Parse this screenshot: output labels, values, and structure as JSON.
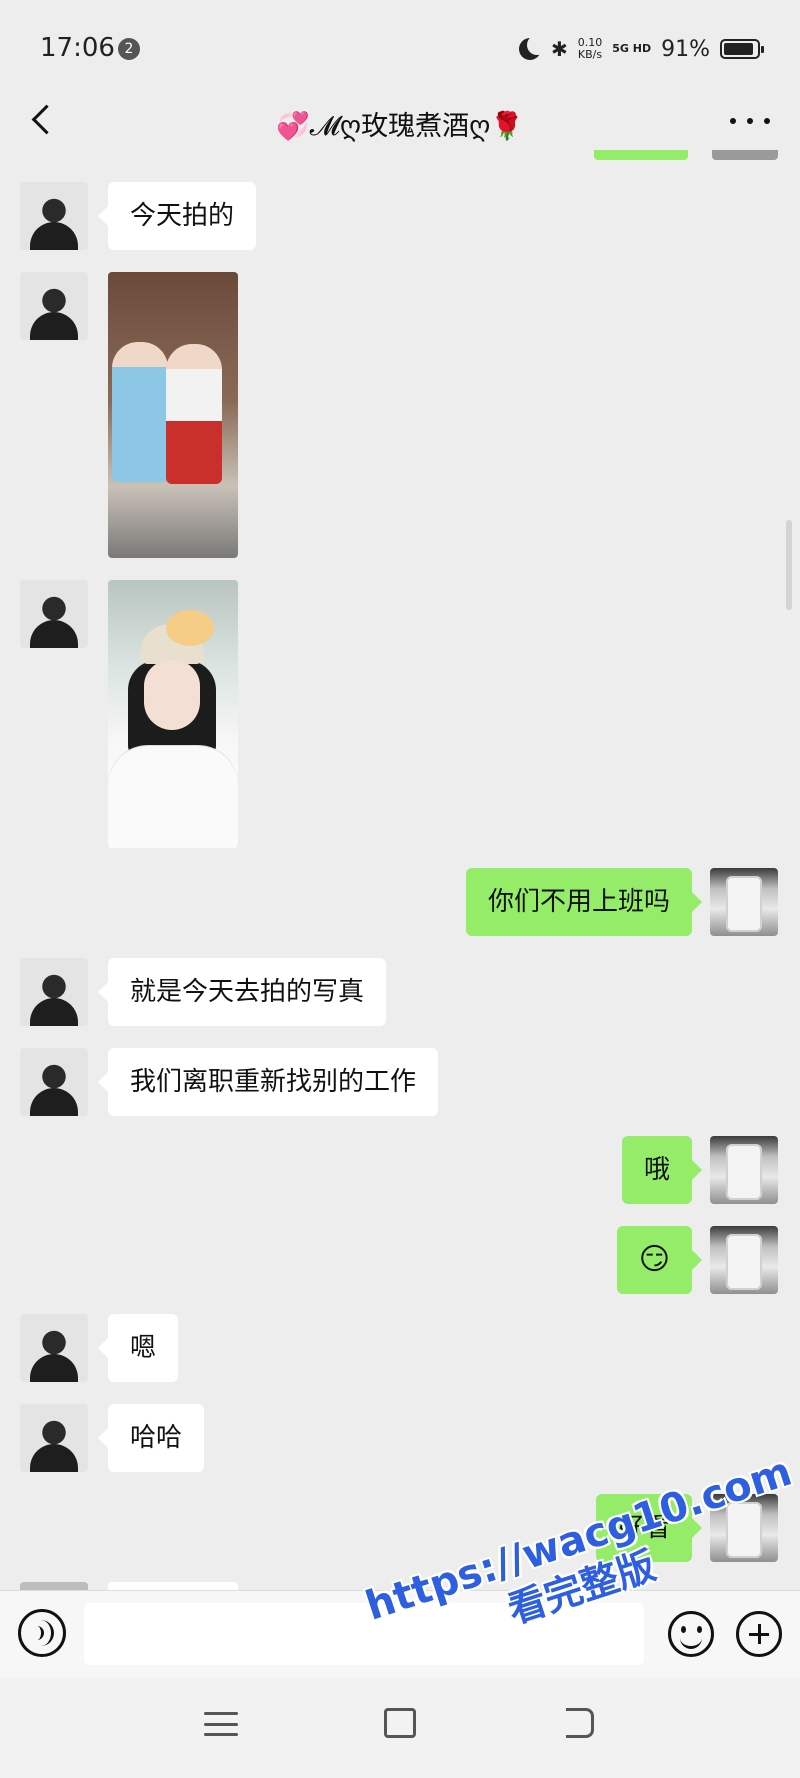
{
  "status_bar": {
    "time": "17:06",
    "notification_badge": "2",
    "net_speed_value": "0.10",
    "net_speed_unit": "KB/s",
    "signal": "5G HD",
    "battery_percent": "91%",
    "battery_level": 0.91
  },
  "header": {
    "title": "💞𝓜ღ玫瑰煮酒ღ🌹"
  },
  "messages": [
    {
      "side": "left",
      "type": "text",
      "text": "今天拍的"
    },
    {
      "side": "left",
      "type": "image",
      "content": "photo-two-women-hanfu"
    },
    {
      "side": "left",
      "type": "image",
      "content": "photo-selfie-girl"
    },
    {
      "side": "right",
      "type": "text",
      "text": "你们不用上班吗"
    },
    {
      "side": "left",
      "type": "text",
      "text": "就是今天去拍的写真"
    },
    {
      "side": "left",
      "type": "text",
      "text": "我们离职重新找别的工作"
    },
    {
      "side": "right",
      "type": "text",
      "text": "哦"
    },
    {
      "side": "right",
      "type": "emoji",
      "text": "😏"
    },
    {
      "side": "left",
      "type": "text",
      "text": "嗯"
    },
    {
      "side": "left",
      "type": "text",
      "text": "哈哈"
    },
    {
      "side": "right",
      "type": "text",
      "text": "好看"
    }
  ],
  "input_bar": {
    "placeholder": ""
  },
  "watermark": {
    "url": "https://wacg10.com",
    "text": "看完整版"
  },
  "icons": {
    "back": "back-chevron-icon",
    "more": "more-dots-icon",
    "voice": "voice-icon",
    "emoji": "emoji-icon",
    "plus": "plus-icon"
  },
  "colors": {
    "background": "#ededed",
    "bubble_self": "#95ec69",
    "bubble_other": "#ffffff",
    "watermark": "#2d5fe0"
  }
}
